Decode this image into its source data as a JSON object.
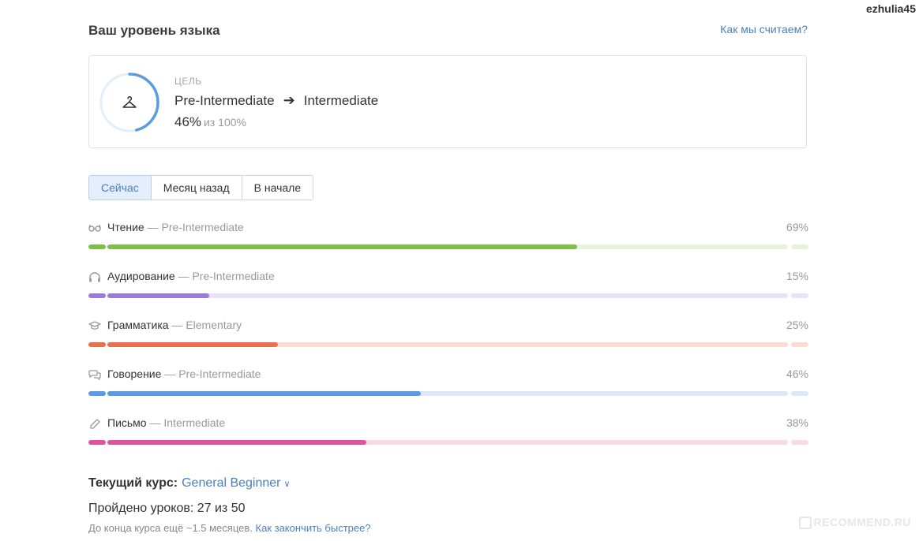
{
  "user": {
    "name": "ezhulia45"
  },
  "header": {
    "title": "Ваш уровень языка",
    "how_link": "Как мы считаем?"
  },
  "goal": {
    "label": "ЦЕЛЬ",
    "from": "Pre-Intermediate",
    "to": "Intermediate",
    "percent_text": "46%",
    "of_text": "из 100%",
    "progress": 46,
    "icon": "hanger-icon"
  },
  "tabs": [
    {
      "label": "Сейчас",
      "active": true
    },
    {
      "label": "Месяц назад",
      "active": false
    },
    {
      "label": "В начале",
      "active": false
    }
  ],
  "skills": [
    {
      "icon": "glasses-icon",
      "name": "Чтение",
      "level": " — Pre-Intermediate",
      "percent_text": "69%",
      "value": 69,
      "color": "#7cc04b",
      "track": "#e6f2dc"
    },
    {
      "icon": "headphones-icon",
      "name": "Аудирование",
      "level": " — Pre-Intermediate",
      "percent_text": "15%",
      "value": 15,
      "color": "#9b7bd8",
      "track": "#e9e2f6"
    },
    {
      "icon": "graduation-cap-icon",
      "name": "Грамматика",
      "level": " — Elementary",
      "percent_text": "25%",
      "value": 25,
      "color": "#e9704f",
      "track": "#fadcd2"
    },
    {
      "icon": "speech-bubbles-icon",
      "name": "Говорение",
      "level": " — Pre-Intermediate",
      "percent_text": "46%",
      "value": 46,
      "color": "#5b9be0",
      "track": "#dbe8f8"
    },
    {
      "icon": "pencil-icon",
      "name": "Письмо",
      "level": " — Intermediate",
      "percent_text": "38%",
      "value": 38,
      "color": "#e0559a",
      "track": "#f8d9e8"
    }
  ],
  "course": {
    "label": "Текущий курс:",
    "name": "General Beginner",
    "lessons": "Пройдено уроков: 27 из 50",
    "remaining": "До конца курса ещё ~1.5 месяцев.",
    "faster_link": "Как закончить быстрее?"
  },
  "watermark": "RECOMMEND.RU",
  "colors": {
    "accent": "#4a7fc1",
    "ring": "#5b9be0",
    "ring_track": "#e3eef9"
  }
}
